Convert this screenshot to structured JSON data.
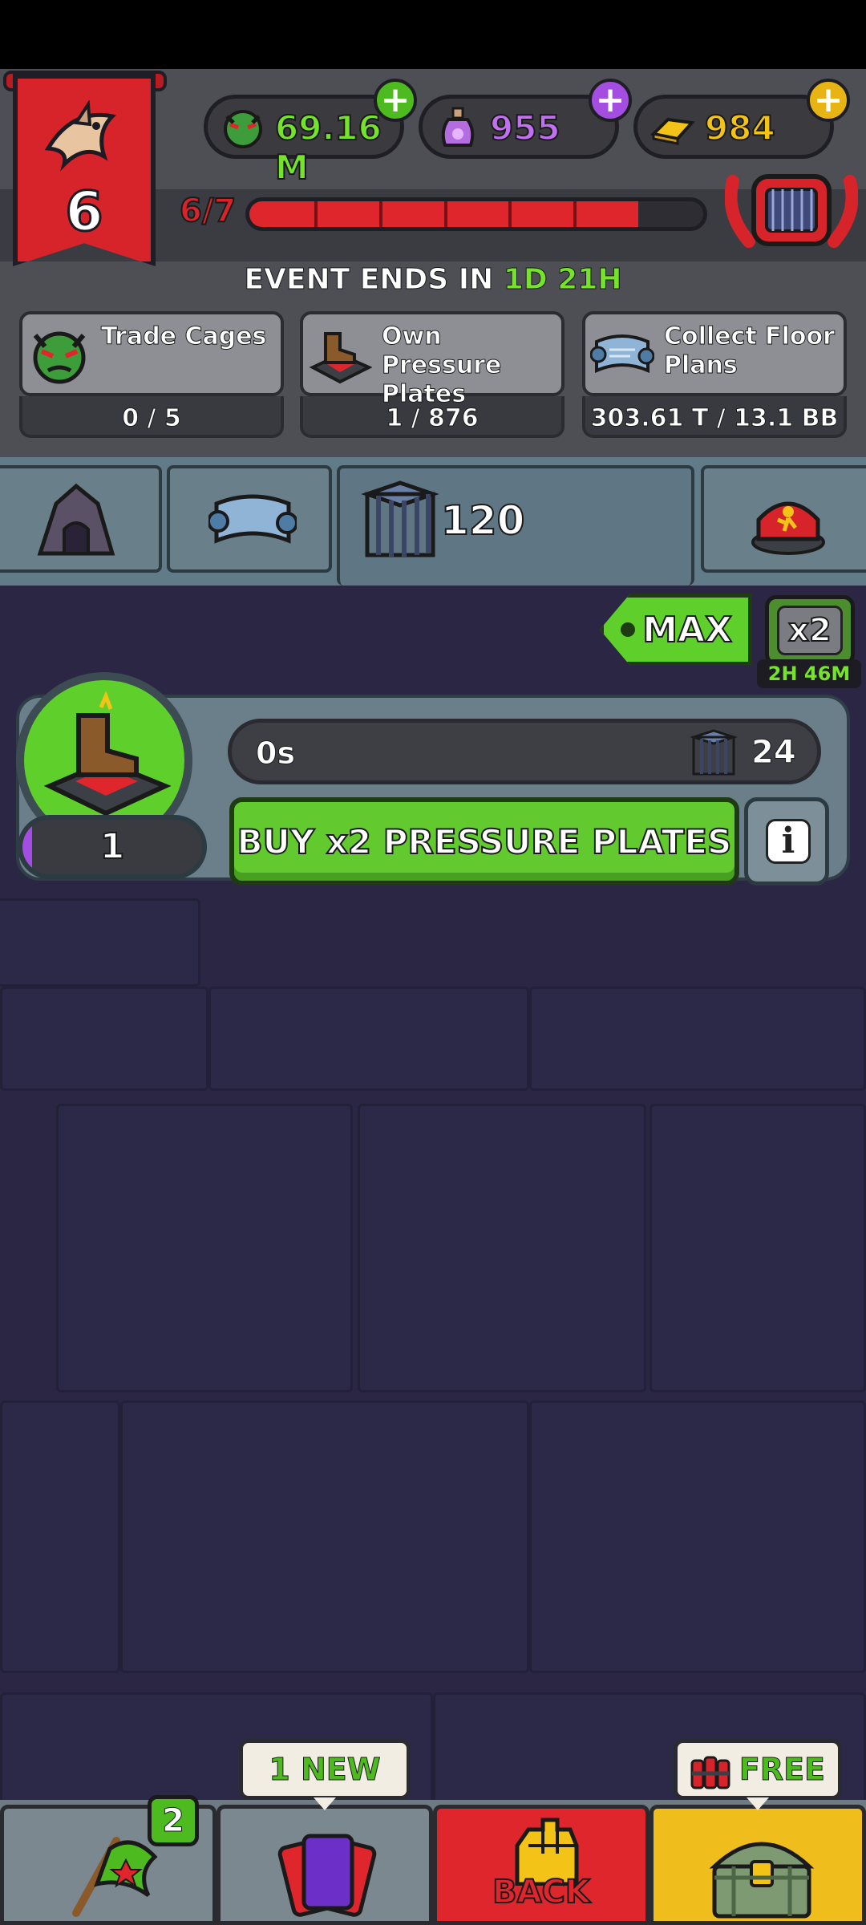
{
  "header": {
    "level": "6",
    "currencies": {
      "cash": "69.16 M",
      "potion": "955",
      "gold": "984"
    },
    "progress": {
      "label": "6/7",
      "current": 6,
      "total": 7
    },
    "event": {
      "prefix": "EVENT ENDS IN",
      "time": "1D 21H"
    }
  },
  "quests": [
    {
      "title": "Trade Cages",
      "progress": "0 / 5",
      "icon": "monster-head-icon"
    },
    {
      "title": "Own Pressure Plates",
      "progress": "1 / 876",
      "icon": "pressure-plate-boot-icon"
    },
    {
      "title": "Collect Floor Plans",
      "progress": "303.61 T / 13.1 BB",
      "icon": "floor-plan-scroll-icon"
    }
  ],
  "tabs": [
    {
      "icon": "cave-icon"
    },
    {
      "icon": "floor-plan-scroll-icon"
    },
    {
      "icon": "cage-icon",
      "count": "120",
      "active": true
    },
    {
      "icon": "alarm-button-icon"
    }
  ],
  "buy_mode": {
    "max_label": "MAX",
    "boost_label": "x2",
    "boost_timer": "2H 46M"
  },
  "generator": {
    "level": "1",
    "timer": "0s",
    "yield": "24",
    "buy_label": "BUY x2 PRESSURE PLATES"
  },
  "bottom_nav": {
    "flag_badge": "2",
    "cards_tooltip": "1 NEW",
    "back_label": "BACK",
    "shop_tooltip": "FREE"
  },
  "colors": {
    "accent_green": "#5fcf2c",
    "alert_red": "#e0262d",
    "purple": "#a34ee0",
    "gold": "#f3c317"
  }
}
